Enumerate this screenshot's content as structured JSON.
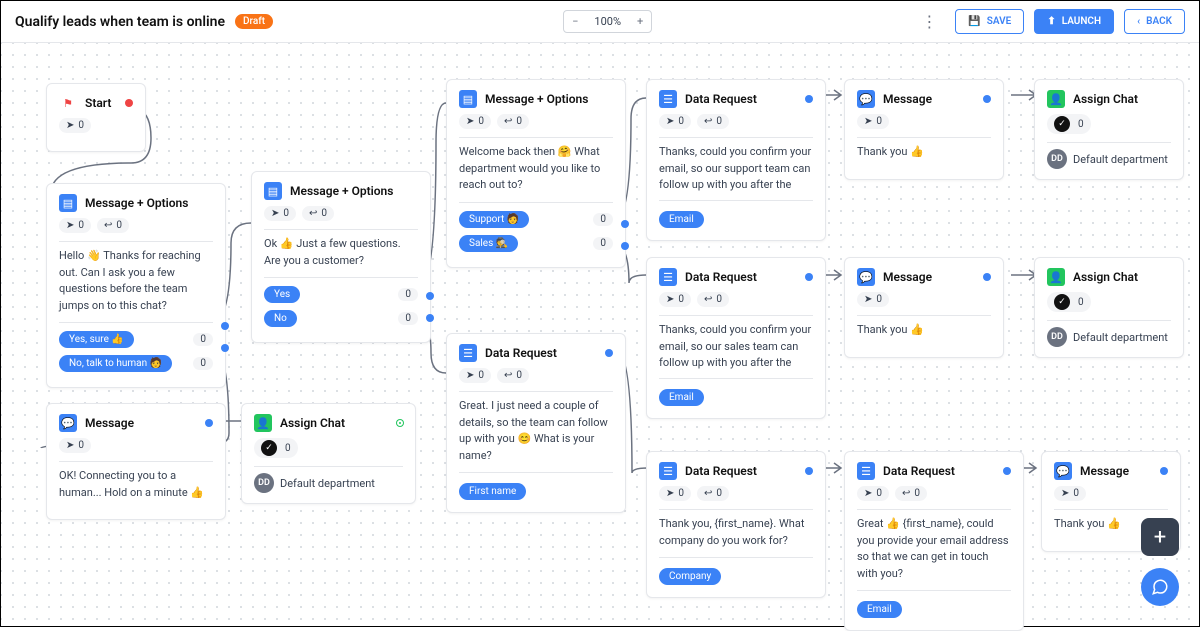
{
  "header": {
    "title": "Qualify leads when team is online",
    "status": "Draft",
    "zoom": "100%",
    "save": "SAVE",
    "launch": "LAUNCH",
    "back": "BACK"
  },
  "nodes": {
    "start": {
      "title": "Start",
      "sent": "0"
    },
    "msgopt1": {
      "title": "Message + Options",
      "sent": "0",
      "recv": "0",
      "body": "Hello 👋 Thanks for reaching out. Can I ask you a few questions before the team jumps on to this chat?",
      "opt1": "Yes, sure 👍",
      "opt2": "No, talk to human 🧑",
      "c1": "0",
      "c2": "0"
    },
    "msgopt2": {
      "title": "Message + Options",
      "sent": "0",
      "recv": "0",
      "body": "Ok 👍 Just a few questions. Are you a customer?",
      "opt1": "Yes",
      "opt2": "No",
      "c1": "0",
      "c2": "0"
    },
    "msgopt3": {
      "title": "Message + Options",
      "sent": "0",
      "recv": "0",
      "body": "Welcome back then 🤗 What department would you like to reach out to?",
      "opt1": "Support 🧑‍",
      "opt2": "Sales 🕵️",
      "c1": "0",
      "c2": "0"
    },
    "msg1": {
      "title": "Message",
      "sent": "0",
      "body": "OK! Connecting you to a human... Hold on a minute 👍"
    },
    "assign1": {
      "title": "Assign Chat",
      "sent": "0",
      "dept": "Default department"
    },
    "data1": {
      "title": "Data Request",
      "sent": "0",
      "recv": "0",
      "body": "Great. I just need a couple of details, so the team can follow up with you 😊 What is your name?",
      "field": "First name"
    },
    "data2": {
      "title": "Data Request",
      "sent": "0",
      "recv": "0",
      "body": "Thanks, could you confirm your email, so our support team can follow up with you after the chat? We promise not to spam you 😇",
      "field": "Email"
    },
    "data3": {
      "title": "Data Request",
      "sent": "0",
      "recv": "0",
      "body": "Thanks, could you confirm your email, so our sales team can follow up with you after the chat? We promise not to spam you 😇",
      "field": "Email"
    },
    "data4": {
      "title": "Data Request",
      "sent": "0",
      "recv": "0",
      "body": "Thank you, {first_name}. What company do you work for?",
      "field": "Company"
    },
    "data5": {
      "title": "Data Request",
      "sent": "0",
      "recv": "0",
      "body": "Great 👍 {first_name}, could you provide your email address so that we can get in touch with you?",
      "field": "Email"
    },
    "msg2": {
      "title": "Message",
      "sent": "0",
      "body": "Thank you 👍"
    },
    "msg3": {
      "title": "Message",
      "sent": "0",
      "body": "Thank you 👍"
    },
    "msg4": {
      "title": "Message",
      "sent": "0",
      "body": "Thank you 👍"
    },
    "assign2": {
      "title": "Assign Chat",
      "sent": "0",
      "dept": "Default department"
    },
    "assign3": {
      "title": "Assign Chat",
      "sent": "0",
      "dept": "Default department"
    }
  }
}
